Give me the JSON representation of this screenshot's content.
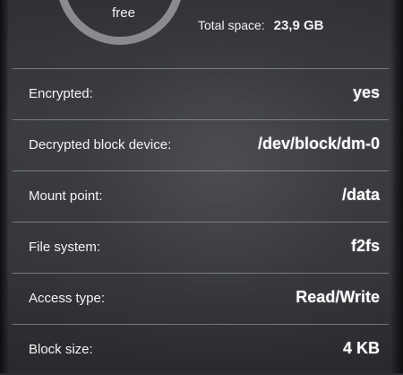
{
  "summary": {
    "free_label": "free",
    "total_label": "Total space:",
    "total_value": "23,9 GB"
  },
  "info_rows": [
    {
      "label": "Encrypted:",
      "value": "yes"
    },
    {
      "label": "Decrypted block device:",
      "value": "/dev/block/dm-0"
    },
    {
      "label": "Mount point:",
      "value": "/data"
    },
    {
      "label": "File system:",
      "value": "f2fs"
    },
    {
      "label": "Access type:",
      "value": "Read/Write"
    },
    {
      "label": "Block size:",
      "value": "4 KB"
    }
  ]
}
